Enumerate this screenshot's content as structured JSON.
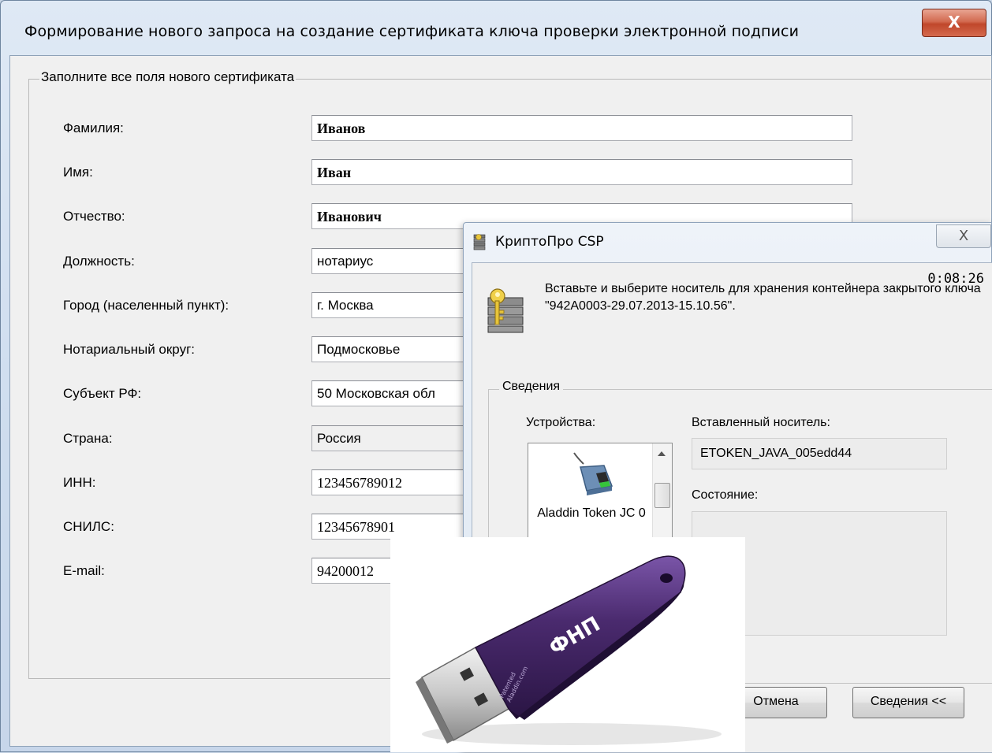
{
  "main_window": {
    "title": "Формирование нового запроса на создание сертификата ключа проверки электронной подписи",
    "close_glyph": "X",
    "group_title": "Заполните все поля нового сертификата",
    "fields": [
      {
        "label": "Фамилия:",
        "value": "Иванов"
      },
      {
        "label": "Имя:",
        "value": "Иван"
      },
      {
        "label": "Отчество:",
        "value": "Иванович"
      },
      {
        "label": "Должность:",
        "value": "нотариус"
      },
      {
        "label": "Город (населенный пункт):",
        "value": "г. Москва"
      },
      {
        "label": "Нотариальный округ:",
        "value": "Подмосковье"
      },
      {
        "label": "Субъект РФ:",
        "value": "50 Московская обл"
      },
      {
        "label": "Страна:",
        "value": "Россия"
      },
      {
        "label": "ИНН:",
        "value": "123456789012"
      },
      {
        "label": "СНИЛС:",
        "value": "12345678901"
      },
      {
        "label": "E-mail:",
        "value": "94200012"
      }
    ]
  },
  "cryptopro_dialog": {
    "title": "КриптоПро CSP",
    "close_glyph": "X",
    "timer": "0:08:26",
    "message": "Вставьте и выберите носитель для хранения контейнера закрытого ключа \"942A0003-29.07.2013-15.10.56\".",
    "group_title": "Сведения",
    "devices_label": "Устройства:",
    "device_name": "Aladdin Token JC 0",
    "inserted_media_label": "Вставленный носитель:",
    "inserted_media_value": "ETOKEN_JAVA_005edd44",
    "state_label": "Состояние:",
    "cancel_button": "Отмена",
    "details_button": "Сведения <<"
  },
  "token_photo": {
    "label": "ФНП",
    "side_text_1": "Aladdin.com",
    "side_text_2": "Patented",
    "colors": {
      "body": "#4a2a6e",
      "plug": "#c8c8c8"
    }
  }
}
